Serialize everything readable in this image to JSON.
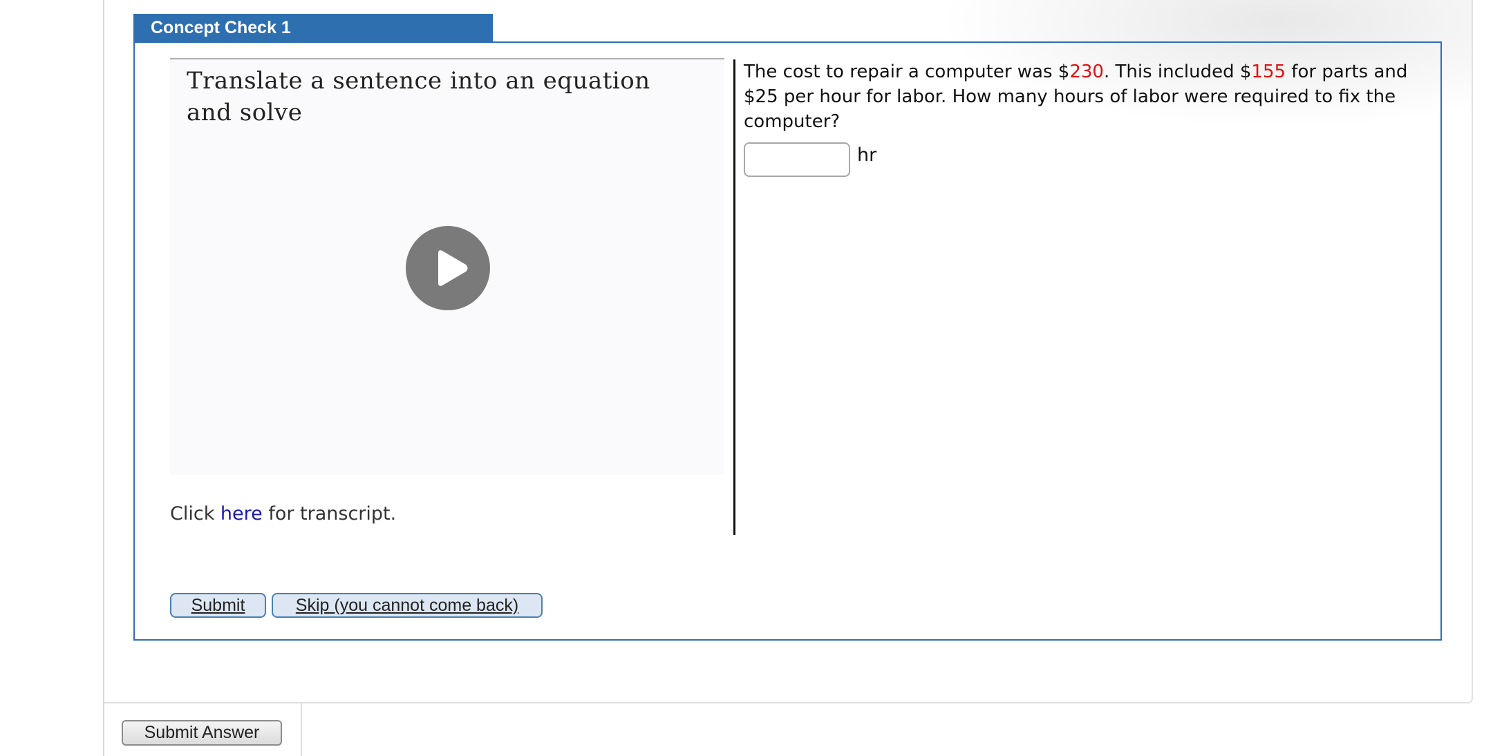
{
  "concept_check": {
    "tab_title": "Concept Check 1"
  },
  "video": {
    "title": "Translate a sentence into an equation and solve",
    "play_icon": "play-icon"
  },
  "transcript": {
    "prefix": "Click ",
    "link_text": "here",
    "suffix": " for transcript."
  },
  "question": {
    "part1": "The cost to repair a computer was $",
    "total_cost": "230",
    "part2": ". This included $",
    "parts_cost": "155",
    "part3": " for parts and $25 per hour for labor. How many hours of labor were required to fix the computer?",
    "highlight_color": "#e01010"
  },
  "answer": {
    "value": "",
    "placeholder": "",
    "unit": "hr"
  },
  "buttons": {
    "submit": "Submit",
    "skip": "Skip (you cannot come back)",
    "submit_answer": "Submit Answer"
  },
  "colors": {
    "accent": "#2e6fb0",
    "button_fill": "#dce7f3"
  }
}
